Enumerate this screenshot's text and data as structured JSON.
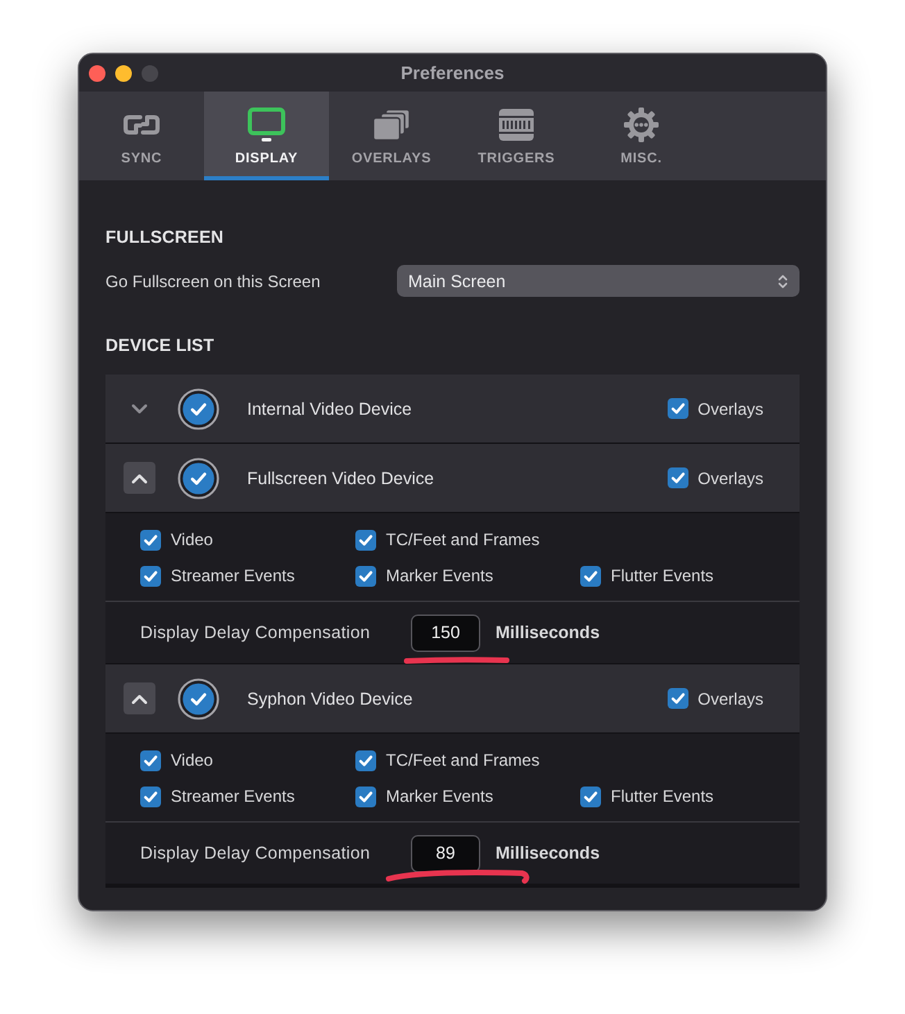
{
  "window": {
    "title": "Preferences"
  },
  "tabs": [
    {
      "label": "SYNC",
      "selected": false
    },
    {
      "label": "DISPLAY",
      "selected": true
    },
    {
      "label": "OVERLAYS",
      "selected": false
    },
    {
      "label": "TRIGGERS",
      "selected": false
    },
    {
      "label": "MISC.",
      "selected": false
    }
  ],
  "fullscreen": {
    "heading": "FULLSCREEN",
    "label": "Go Fullscreen on this Screen",
    "screen_select": {
      "value": "Main Screen"
    }
  },
  "device_list": {
    "heading": "DEVICE LIST",
    "devices": [
      {
        "name": "Internal Video Device",
        "enabled": true,
        "expanded": false,
        "overlays": {
          "label": "Overlays",
          "checked": true
        }
      },
      {
        "name": "Fullscreen Video Device",
        "enabled": true,
        "expanded": true,
        "overlays": {
          "label": "Overlays",
          "checked": true
        },
        "option_rows": [
          [
            {
              "label": "Video",
              "checked": true
            },
            {
              "label": "TC/Feet and Frames",
              "checked": true
            }
          ],
          [
            {
              "label": "Streamer Events",
              "checked": true
            },
            {
              "label": "Marker Events",
              "checked": true
            },
            {
              "label": "Flutter Events",
              "checked": true
            }
          ]
        ],
        "delay": {
          "label": "Display Delay Compensation",
          "value": "150",
          "unit": "Milliseconds",
          "underlined": true
        }
      },
      {
        "name": "Syphon Video Device",
        "enabled": true,
        "expanded": true,
        "overlays": {
          "label": "Overlays",
          "checked": true
        },
        "option_rows": [
          [
            {
              "label": "Video",
              "checked": true
            },
            {
              "label": "TC/Feet and Frames",
              "checked": true
            }
          ],
          [
            {
              "label": "Streamer Events",
              "checked": true
            },
            {
              "label": "Marker Events",
              "checked": true
            },
            {
              "label": "Flutter Events",
              "checked": true
            }
          ]
        ],
        "delay": {
          "label": "Display Delay Compensation",
          "value": "89",
          "unit": "Milliseconds",
          "underlined": true
        }
      }
    ]
  }
}
